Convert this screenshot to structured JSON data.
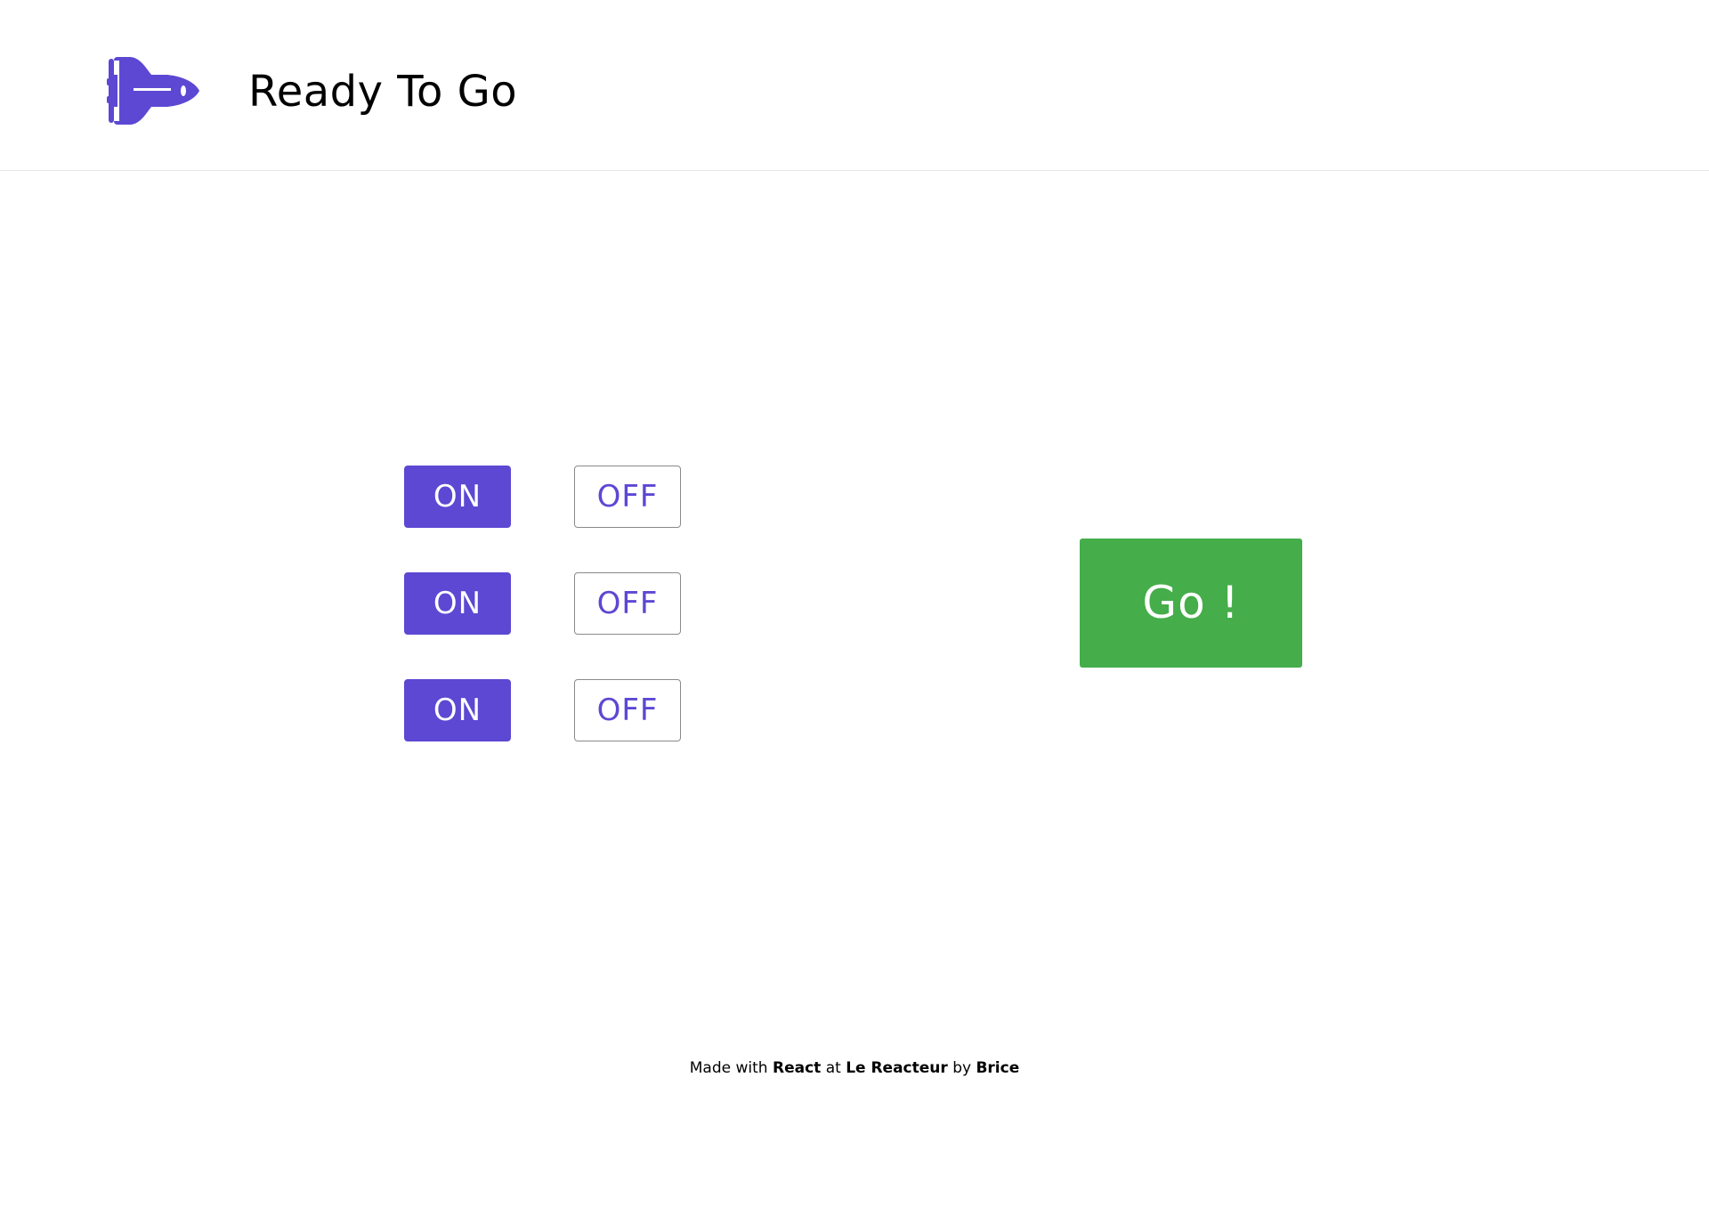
{
  "header": {
    "logo_icon": "space-shuttle-icon",
    "title": "Ready To Go"
  },
  "switches": [
    {
      "on_label": "ON",
      "off_label": "OFF",
      "state": "on"
    },
    {
      "on_label": "ON",
      "off_label": "OFF",
      "state": "on"
    },
    {
      "on_label": "ON",
      "off_label": "OFF",
      "state": "on"
    }
  ],
  "go_button": {
    "label": "Go !"
  },
  "footer": {
    "made_with": "Made with",
    "tech": "React",
    "at": "at",
    "school": "Le Reacteur",
    "by": "by",
    "author": "Brice"
  },
  "colors": {
    "accent": "#5c48d3",
    "go": "#45ad4a",
    "text": "#000000",
    "background": "#ffffff"
  }
}
